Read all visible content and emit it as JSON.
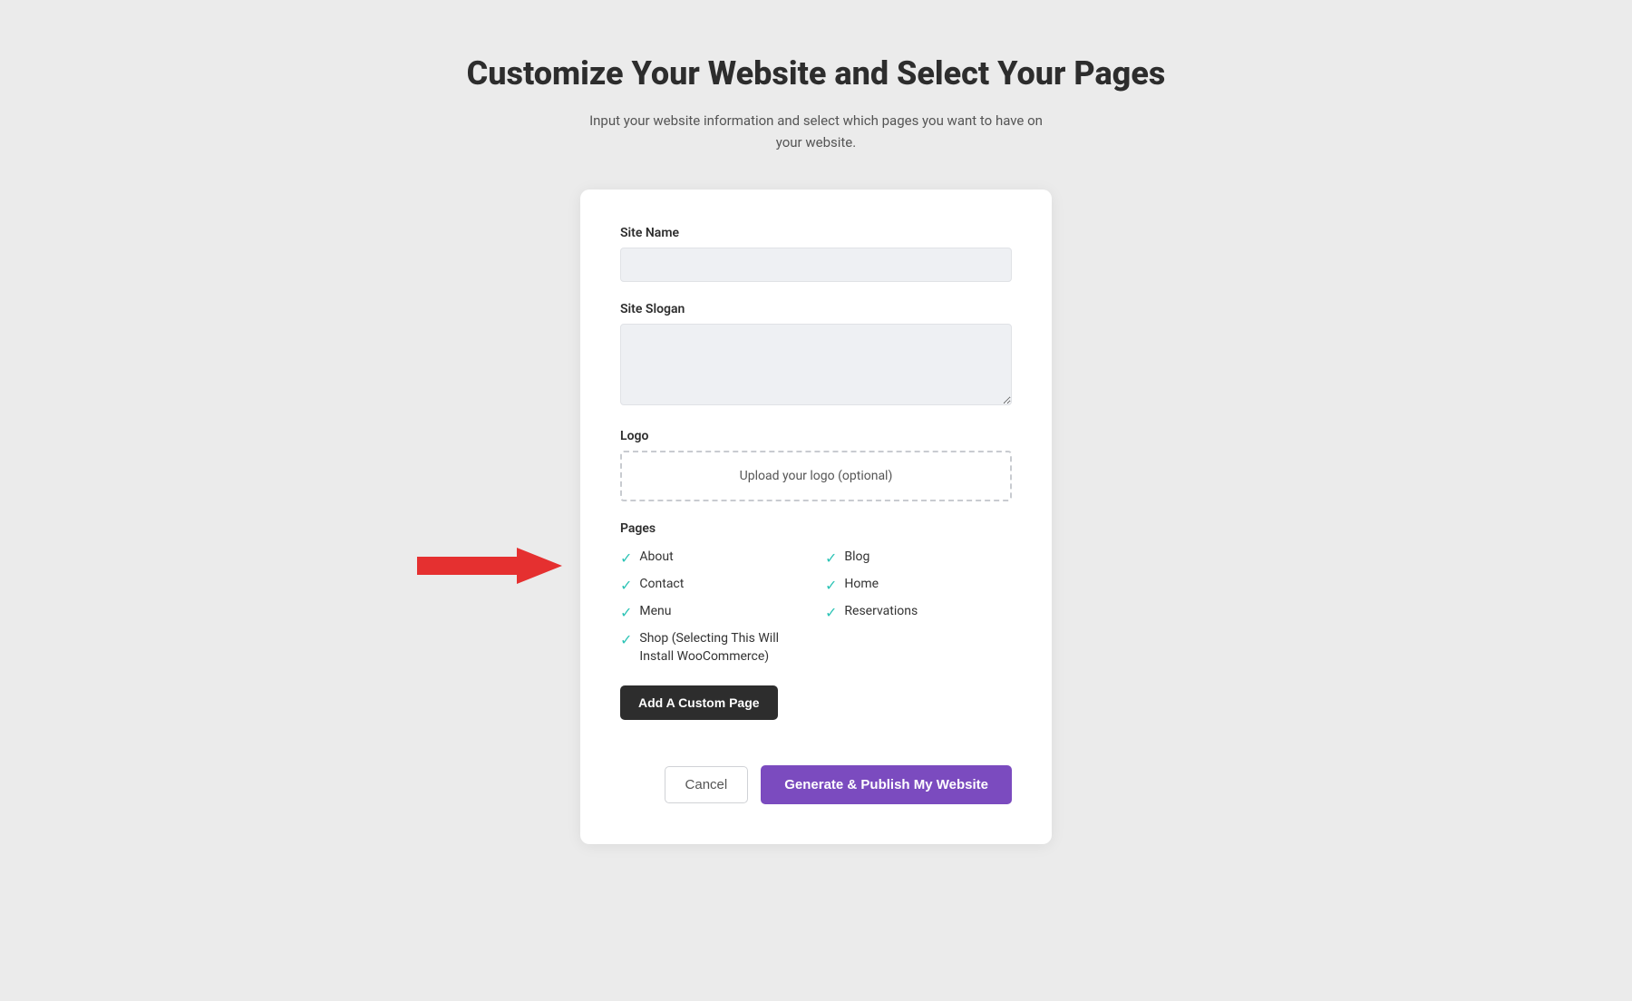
{
  "header": {
    "title": "Customize Your Website and Select Your Pages",
    "subtitle": "Input your website information and select which pages you want to have on your website."
  },
  "form": {
    "site_name_label": "Site Name",
    "site_name_placeholder": "",
    "site_slogan_label": "Site Slogan",
    "site_slogan_placeholder": "",
    "logo_label": "Logo",
    "logo_upload_text": "Upload your logo (optional)",
    "pages_label": "Pages",
    "pages": [
      {
        "id": "about",
        "label": "About",
        "checked": true,
        "col": 1
      },
      {
        "id": "blog",
        "label": "Blog",
        "checked": true,
        "col": 2
      },
      {
        "id": "contact",
        "label": "Contact",
        "checked": true,
        "col": 1
      },
      {
        "id": "home",
        "label": "Home",
        "checked": true,
        "col": 2
      },
      {
        "id": "menu",
        "label": "Menu",
        "checked": true,
        "col": 1
      },
      {
        "id": "reservations",
        "label": "Reservations",
        "checked": true,
        "col": 2
      },
      {
        "id": "shop",
        "label": "Shop (Selecting This Will Install WooCommerce)",
        "checked": true,
        "col": 1
      }
    ],
    "add_custom_page_label": "Add A Custom Page",
    "cancel_label": "Cancel",
    "generate_label": "Generate & Publish My Website"
  },
  "colors": {
    "check": "#2ec4b6",
    "add_btn_bg": "#2d2d2d",
    "generate_btn_bg": "#7b4bbf",
    "cancel_border": "#d0d2d6",
    "arrow_red": "#e53030"
  }
}
